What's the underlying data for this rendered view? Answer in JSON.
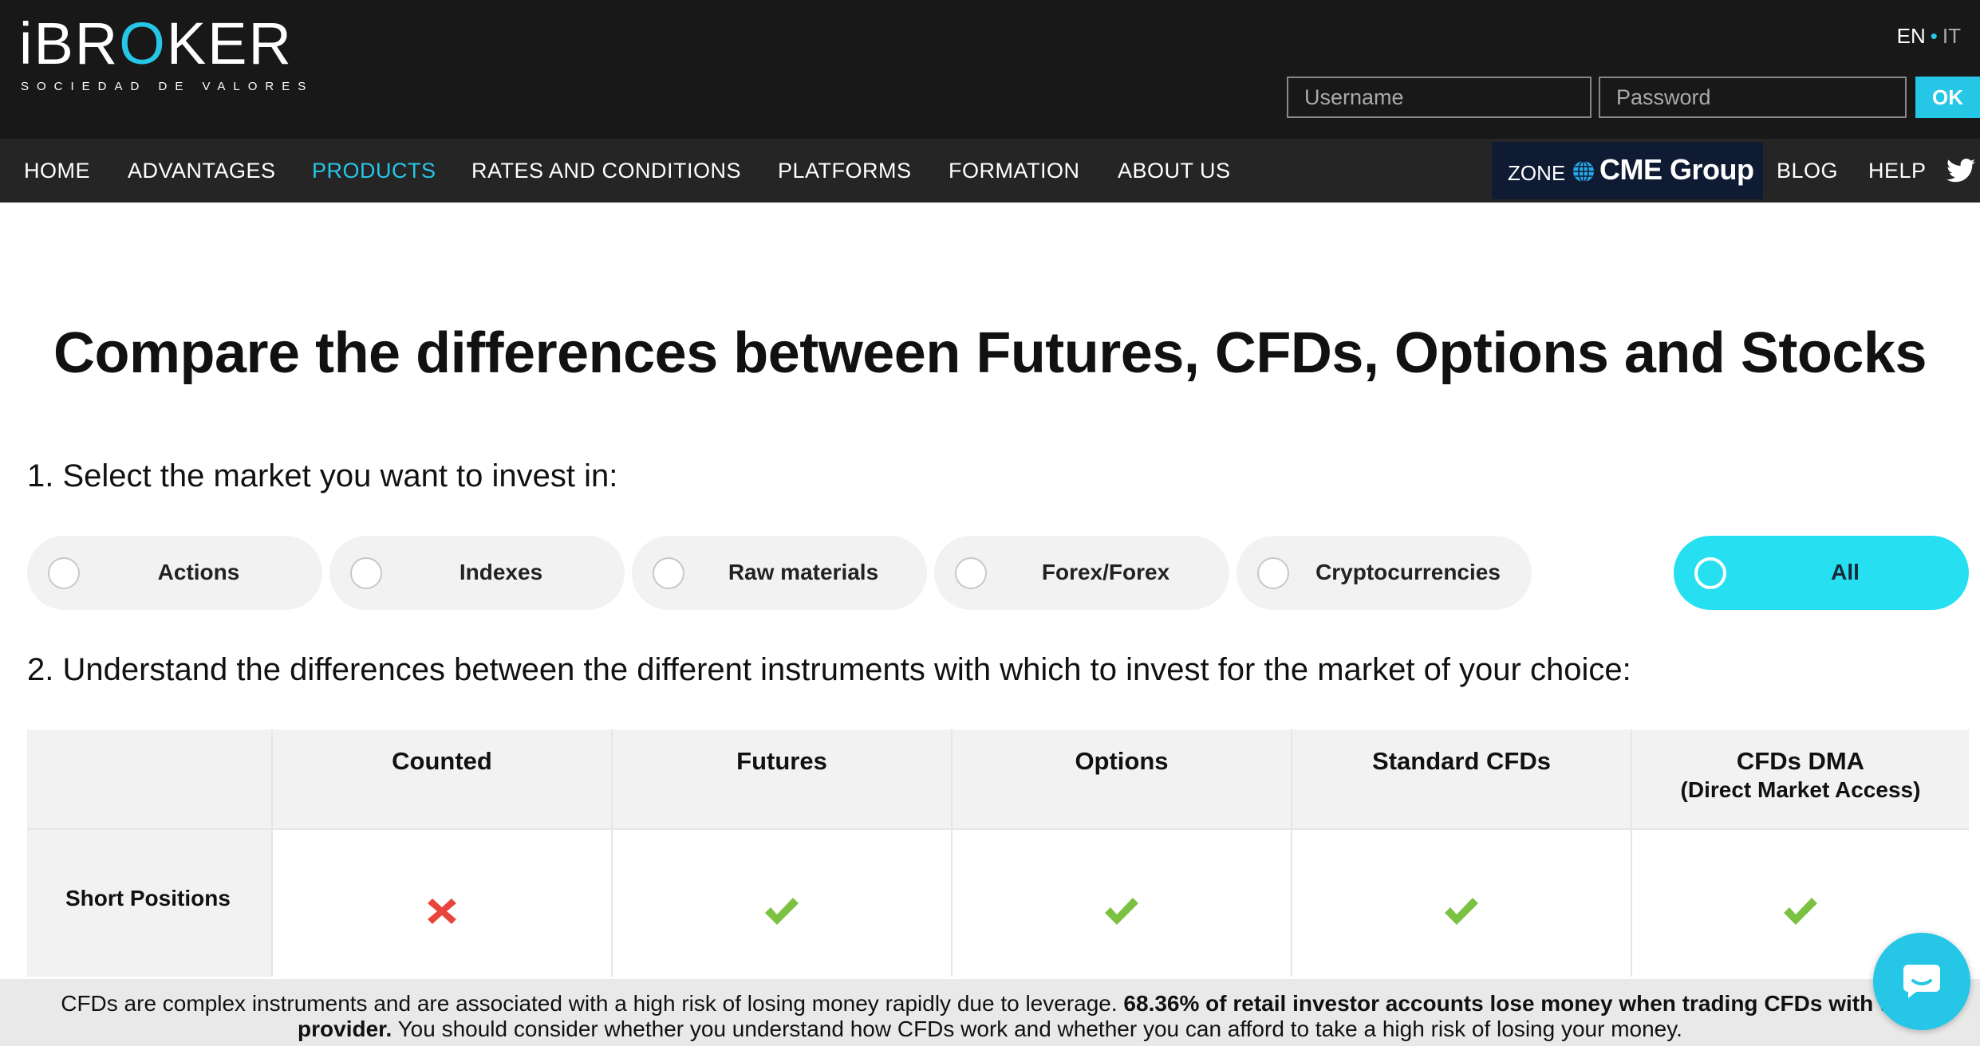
{
  "brand": {
    "name_pre": "iBR",
    "name_o": "O",
    "name_post": "KER",
    "tagline": "SOCIEDAD DE VALORES"
  },
  "lang": {
    "en": "EN",
    "separator": "•",
    "it": "IT"
  },
  "login": {
    "username_placeholder": "Username",
    "password_placeholder": "Password",
    "ok_label": "OK"
  },
  "nav": {
    "items": [
      "HOME",
      "ADVANTAGES",
      "PRODUCTS",
      "RATES AND CONDITIONS",
      "PLATFORMS",
      "FORMATION",
      "ABOUT US"
    ],
    "active": "PRODUCTS",
    "zone_label": "ZONE",
    "zone_brand": "CME Group",
    "blog": "BLOG",
    "help": "HELP"
  },
  "page": {
    "title": "Compare the differences between Futures, CFDs, Options and Stocks",
    "step1": "1. Select the market you want to invest in:",
    "step2": "2. Understand the differences between the different instruments with which to invest for the market of your choice:"
  },
  "markets": [
    "Actions",
    "Indexes",
    "Raw materials",
    "Forex/Forex",
    "Cryptocurrencies",
    "All"
  ],
  "selected_market": "All",
  "table": {
    "headers": [
      "Counted",
      "Futures",
      "Options",
      "Standard CFDs",
      "CFDs DMA"
    ],
    "dma_subheader": "(Direct Market Access)",
    "rows": [
      {
        "label": "Short Positions",
        "values": [
          "no",
          "yes",
          "yes",
          "yes",
          "yes"
        ]
      }
    ]
  },
  "disclaimer": {
    "part1": "CFDs are complex instruments and are associated with a high risk of losing money rapidly due to leverage.",
    "bold1": "68.36% of retail investor accounts lose money when trading CFDs with this",
    "bold2": "provider.",
    "part2": "You should consider whether you understand how CFDs work and whether you can afford to take a high risk of losing your money."
  },
  "colors": {
    "accent": "#26c6e6",
    "header_bg": "#181818",
    "nav_bg": "#252525",
    "check": "#7cc242",
    "cross": "#e8453c",
    "zone_bg": "#0f1b33"
  }
}
